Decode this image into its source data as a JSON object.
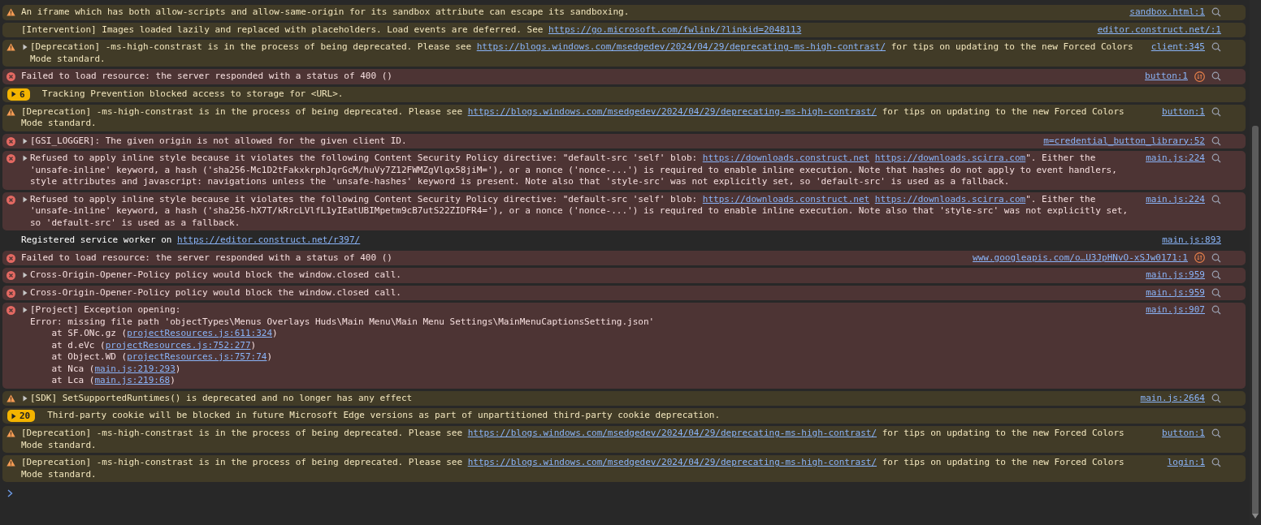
{
  "messages": [
    {
      "kind": "warning",
      "expandable": false,
      "parts": [
        {
          "kind": "text",
          "text": "An iframe which has both allow-scripts and allow-same-origin for its sandbox attribute can escape its sandboxing."
        }
      ],
      "source": "sandbox.html:1",
      "network": false,
      "lookup": true
    },
    {
      "kind": "intervention",
      "expandable": false,
      "parts": [
        {
          "kind": "text",
          "text": "[Intervention] Images loaded lazily and replaced with placeholders. Load events are deferred. See "
        },
        {
          "kind": "link",
          "text": "https://go.microsoft.com/fwlink/?linkid=2048113"
        }
      ],
      "source": "editor.construct.net/:1",
      "network": false,
      "lookup": false
    },
    {
      "kind": "warning",
      "expandable": true,
      "parts": [
        {
          "kind": "text",
          "text": "[Deprecation] -ms-high-constrast is in the process of being deprecated. Please see "
        },
        {
          "kind": "link",
          "text": "https://blogs.windows.com/msedgedev/2024/04/29/deprecating-ms-high-contrast/"
        },
        {
          "kind": "text",
          "text": " for tips on updating to the new Forced Colors Mode standard."
        }
      ],
      "source": "client:345",
      "network": false,
      "lookup": true
    },
    {
      "kind": "error",
      "expandable": false,
      "parts": [
        {
          "kind": "text",
          "text": "Failed to load resource: the server responded with a status of 400 ()"
        }
      ],
      "source": "button:1",
      "network": true,
      "lookup": true
    },
    {
      "kind": "warning",
      "count": "6",
      "expandable": false,
      "parts": [
        {
          "kind": "text",
          "text": "Tracking Prevention blocked access to storage for <URL>."
        }
      ],
      "network": false,
      "lookup": false
    },
    {
      "kind": "warning",
      "expandable": false,
      "parts": [
        {
          "kind": "text",
          "text": "[Deprecation] -ms-high-constrast is in the process of being deprecated. Please see "
        },
        {
          "kind": "link",
          "text": "https://blogs.windows.com/msedgedev/2024/04/29/deprecating-ms-high-contrast/"
        },
        {
          "kind": "text",
          "text": " for tips on updating to the new Forced Colors Mode standard."
        }
      ],
      "source": "button:1",
      "network": false,
      "lookup": true
    },
    {
      "kind": "error",
      "expandable": true,
      "parts": [
        {
          "kind": "text",
          "text": "[GSI_LOGGER]: The given origin is not allowed for the given client ID."
        }
      ],
      "source": "m=credential_button_library:52",
      "network": false,
      "lookup": true
    },
    {
      "kind": "error",
      "expandable": true,
      "parts": [
        {
          "kind": "text",
          "text": "Refused to apply inline style because it violates the following Content Security Policy directive: \"default-src 'self' blob: "
        },
        {
          "kind": "link",
          "text": "https://downloads.construct.net"
        },
        {
          "kind": "link",
          "text": "https://downloads.scirra.com"
        },
        {
          "kind": "text",
          "text": "\". Either the 'unsafe-inline' keyword, a hash ('sha256-Mc1D2tFakxkrphJqrGcM/huVy7Z12FWMZgVlqx58jiM='), or a nonce ('nonce-...') is required to enable inline execution. Note that hashes do not apply to event handlers, style attributes and javascript: navigations unless the 'unsafe-hashes' keyword is present. Note also that 'style-src' was not explicitly set, so 'default-src' is used as a fallback."
        }
      ],
      "source": "main.js:224",
      "network": false,
      "lookup": true
    },
    {
      "kind": "error",
      "expandable": true,
      "parts": [
        {
          "kind": "text",
          "text": "Refused to apply inline style because it violates the following Content Security Policy directive: \"default-src 'self' blob: "
        },
        {
          "kind": "link",
          "text": "https://downloads.construct.net"
        },
        {
          "kind": "link",
          "text": "https://downloads.scirra.com"
        },
        {
          "kind": "text",
          "text": "\". Either the 'unsafe-inline' keyword, a hash ('sha256-hX7T/kRrcLVlfL1yIEatUBIMpetm9cB7utS22ZIDFR4='), or a nonce ('nonce-...') is required to enable inline execution. Note also that 'style-src' was not explicitly set, so 'default-src' is used as a fallback."
        }
      ],
      "source": "main.js:224",
      "network": false,
      "lookup": true
    },
    {
      "kind": "info",
      "expandable": false,
      "parts": [
        {
          "kind": "text",
          "text": "Registered service worker on "
        },
        {
          "kind": "link",
          "text": "https://editor.construct.net/r397/"
        }
      ],
      "source": "main.js:893",
      "network": false,
      "lookup": false
    },
    {
      "kind": "error",
      "expandable": false,
      "parts": [
        {
          "kind": "text",
          "text": "Failed to load resource: the server responded with a status of 400 ()"
        }
      ],
      "source": "www.googleapis.com/o…U3JpHNvO-xSJw0171:1",
      "network": true,
      "lookup": true
    },
    {
      "kind": "error",
      "expandable": true,
      "parts": [
        {
          "kind": "text",
          "text": "Cross-Origin-Opener-Policy policy would block the window.closed call."
        }
      ],
      "source": "main.js:959",
      "network": false,
      "lookup": true
    },
    {
      "kind": "error",
      "expandable": true,
      "parts": [
        {
          "kind": "text",
          "text": "Cross-Origin-Opener-Policy policy would block the window.closed call."
        }
      ],
      "source": "main.js:959",
      "network": false,
      "lookup": true
    },
    {
      "kind": "error",
      "expandable": true,
      "parts": [
        {
          "kind": "text",
          "text": "[Project] Exception opening:\nError: missing file path 'objectTypes\\Menus Overlays Huds\\Main Menu\\Main Menu Settings\\MainMenuCaptionsSetting.json'\n    at SF.ONc.gz ("
        },
        {
          "kind": "link",
          "text": "projectResources.js:611:324"
        },
        {
          "kind": "text",
          "text": ")\n    at d.eVc ("
        },
        {
          "kind": "link",
          "text": "projectResources.js:752:277"
        },
        {
          "kind": "text",
          "text": ")\n    at Object.WD ("
        },
        {
          "kind": "link",
          "text": "projectResources.js:757:74"
        },
        {
          "kind": "text",
          "text": ")\n    at Nca ("
        },
        {
          "kind": "link",
          "text": "main.js:219:293"
        },
        {
          "kind": "text",
          "text": ")\n    at Lca ("
        },
        {
          "kind": "link",
          "text": "main.js:219:68"
        },
        {
          "kind": "text",
          "text": ")"
        }
      ],
      "source": "main.js:907",
      "network": false,
      "lookup": true
    },
    {
      "kind": "warning",
      "expandable": true,
      "parts": [
        {
          "kind": "text",
          "text": "[SDK] SetSupportedRuntimes() is deprecated and no longer has any effect"
        }
      ],
      "source": "main.js:2664",
      "network": false,
      "lookup": true
    },
    {
      "kind": "warning",
      "count": "20",
      "expandable": false,
      "parts": [
        {
          "kind": "text",
          "text": "Third-party cookie will be blocked in future Microsoft Edge versions as part of unpartitioned third-party cookie deprecation."
        }
      ],
      "network": false,
      "lookup": false
    },
    {
      "kind": "warning",
      "expandable": false,
      "parts": [
        {
          "kind": "text",
          "text": "[Deprecation] -ms-high-constrast is in the process of being deprecated. Please see "
        },
        {
          "kind": "link",
          "text": "https://blogs.windows.com/msedgedev/2024/04/29/deprecating-ms-high-contrast/"
        },
        {
          "kind": "text",
          "text": " for tips on updating to the new Forced Colors Mode standard."
        }
      ],
      "source": "button:1",
      "network": false,
      "lookup": true
    },
    {
      "kind": "warning",
      "expandable": false,
      "parts": [
        {
          "kind": "text",
          "text": "[Deprecation] -ms-high-constrast is in the process of being deprecated. Please see "
        },
        {
          "kind": "link",
          "text": "https://blogs.windows.com/msedgedev/2024/04/29/deprecating-ms-high-contrast/"
        },
        {
          "kind": "text",
          "text": " for tips on updating to the new Forced Colors Mode standard."
        }
      ],
      "source": "login:1",
      "network": false,
      "lookup": true
    }
  ]
}
